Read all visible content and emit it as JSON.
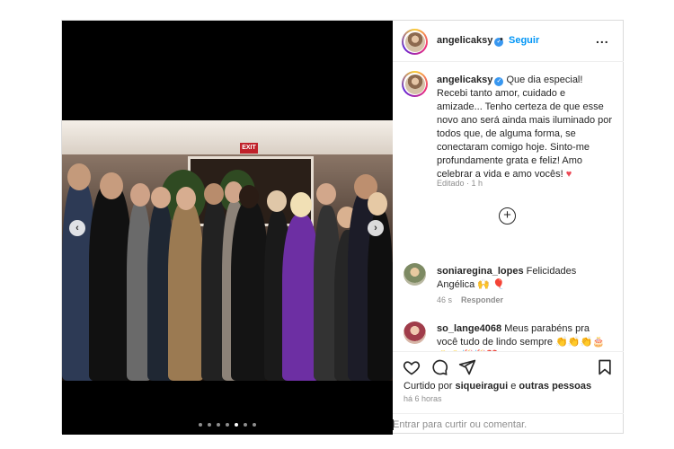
{
  "header": {
    "username": "angelicaksy",
    "separator": "•",
    "follow_label": "Seguir",
    "more_label": "..."
  },
  "caption": {
    "username": "angelicaksy",
    "text": "Que dia especial! Recebi tanto amor, cuidado e amizade... Tenho certeza de que esse novo ano será ainda mais iluminado por todos que, de alguma forma, se conectaram comigo hoje. Sinto-me profundamente grata e feliz! Amo celebrar a vida e amo vocês!",
    "emoji": "♥",
    "meta": "Editado · 1 h"
  },
  "media": {
    "exit_sign": "EXIT",
    "prev_label": "‹",
    "next_label": "›",
    "slide_count": 7,
    "active_slide": 5
  },
  "comments": [
    {
      "username": "soniaregina_lopes",
      "text": "Felicidades Angélica 🙌 🎈",
      "age": "46 s",
      "reply_label": "Responder"
    },
    {
      "username": "so_lange4068",
      "text": "Meus parabéns pra você tudo de lindo sempre 👏👏👏🎂🎂🎂🎉🎉❤️"
    }
  ],
  "likes": {
    "prefix": "Curtido por",
    "user": "siqueiragui",
    "connector": "e",
    "others": "outras pessoas"
  },
  "time_ago": "há 6 horas",
  "comment_box": {
    "placeholder": "Entrar para curtir ou comentar."
  },
  "icons": {
    "add": "+",
    "verified": "✓"
  },
  "colors": {
    "link_blue": "#0095f6",
    "verified_blue": "#3897f0",
    "like_red": "#ed4956",
    "muted": "#8e8e8e"
  }
}
